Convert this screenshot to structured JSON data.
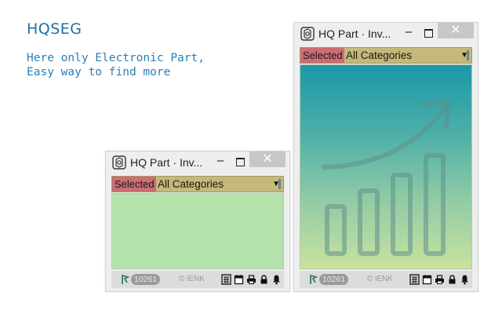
{
  "brand": {
    "name": "HQSEG"
  },
  "tagline": {
    "line1": "Here only Electronic Part,",
    "line2": "Easy way to find more"
  },
  "window": {
    "title": "HQ Part · Inv...",
    "minimize_glyph": "–",
    "close_glyph": "✕",
    "selected_label": "Selected",
    "category": "All Categories",
    "dropdown_glyph": "▼",
    "user_count": "10261",
    "copyright": "© iENK",
    "icons": [
      "app-logo-icon",
      "minimize-icon",
      "maximize-icon",
      "close-icon",
      "dropdown-arrow-icon",
      "user-icon",
      "calculator-icon",
      "calendar-icon",
      "print-icon",
      "lock-icon",
      "bell-icon"
    ]
  },
  "colors": {
    "brand": "#1f6fa8",
    "toolbar": "#c4b87a",
    "selected": "#cc6c74",
    "small_content": "#b3e3aa",
    "gradient_top": "#1a98a9",
    "gradient_bottom": "#c9e29f",
    "status_bar": "#dcdcdc"
  }
}
